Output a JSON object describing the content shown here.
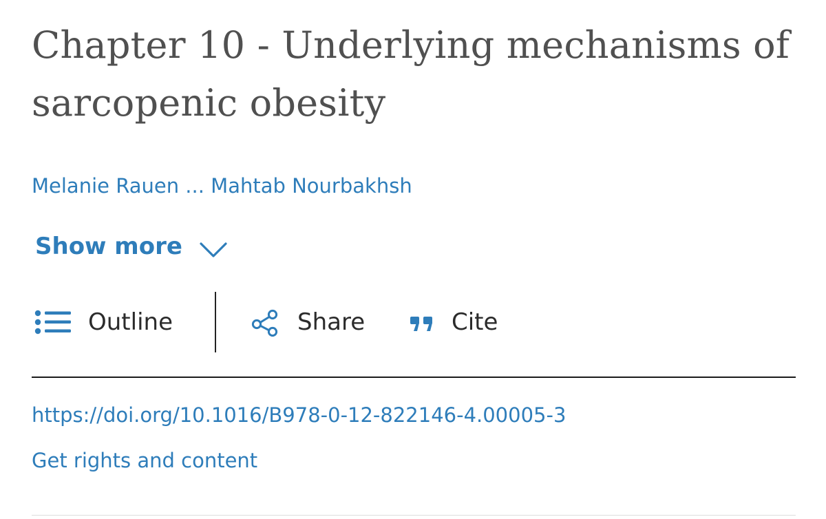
{
  "article": {
    "title": "Chapter 10 - Underlying mechanisms of sarcopenic obesity",
    "authors": {
      "first": "Melanie Rauen",
      "ellipsis": " ... ",
      "last": "Mahtab Nourbakhsh"
    },
    "show_more_label": "Show more",
    "doi_link": "https://doi.org/10.1016/B978-0-12-822146-4.00005-3",
    "rights_link": "Get rights and content"
  },
  "toolbar": {
    "outline_label": "Outline",
    "share_label": "Share",
    "cite_label": "Cite",
    "icons": {
      "outline": "list-icon",
      "share": "share-icon",
      "cite": "quote-icon",
      "show_more": "chevron-down-icon"
    }
  },
  "colors": {
    "link_blue": "#2e7dba",
    "title_gray": "#505050",
    "text_dark": "#2b2b2b",
    "rule": "#1a1a1a"
  }
}
